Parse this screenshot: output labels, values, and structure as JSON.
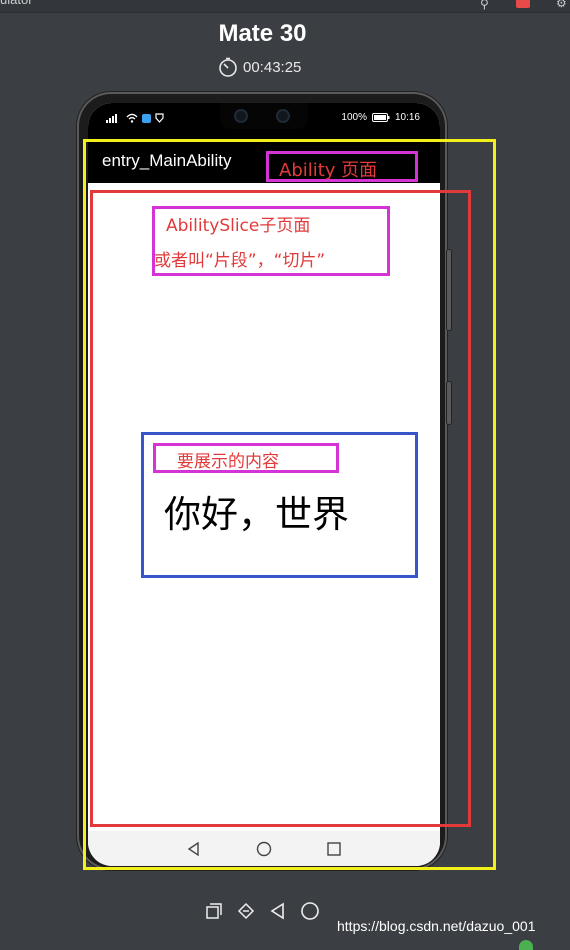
{
  "window": {
    "title": "ulator"
  },
  "device": {
    "name": "Mate 30",
    "timer": "00:43:25"
  },
  "statusbar": {
    "battery": "100%",
    "time": "10:16"
  },
  "app": {
    "title": "entry_MainAbility",
    "hello_text": "你好，世界"
  },
  "annotations": {
    "ability_page": "Ability 页面",
    "ability_slice": "AbilitySlice子页面",
    "slice_alias": "或者叫“片段”，“切片”",
    "content_label": "要展示的内容"
  },
  "watermark": "https://blog.csdn.net/dazuo_001",
  "colors": {
    "yellow": "#f2ef1b",
    "red": "#e23a3a",
    "magenta": "#d633d6",
    "blue": "#3a55c9"
  },
  "icons": {
    "nav": [
      "back-triangle-icon",
      "home-circle-icon",
      "recent-square-icon"
    ],
    "tools": [
      "rotate-icon",
      "tag-icon",
      "back-triangle-icon",
      "home-circle-icon"
    ]
  }
}
